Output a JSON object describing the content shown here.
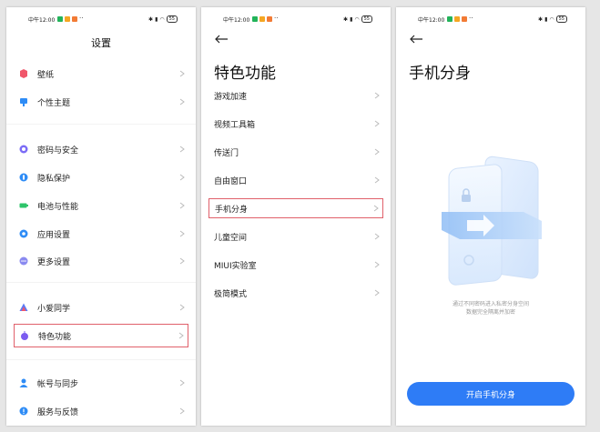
{
  "status": {
    "time": "中午12:00",
    "more": "··",
    "battery": "55",
    "dot_colors": [
      "#22b35a",
      "#f5a623",
      "#f27b35"
    ]
  },
  "panel1": {
    "title": "设置",
    "items": [
      {
        "label": "壁纸",
        "icon": "wallpaper-icon",
        "color": "#f0566a"
      },
      {
        "label": "个性主题",
        "icon": "theme-icon",
        "color": "#2e8cf6"
      },
      {
        "label": "密码与安全",
        "icon": "lock-icon",
        "color": "#7b6cf6"
      },
      {
        "label": "隐私保护",
        "icon": "privacy-icon",
        "color": "#2e8cf6"
      },
      {
        "label": "电池与性能",
        "icon": "battery-icon",
        "color": "#2ec46a"
      },
      {
        "label": "应用设置",
        "icon": "gear-icon",
        "color": "#2e8cf6"
      },
      {
        "label": "更多设置",
        "icon": "more-icon",
        "color": "#8a8af0"
      },
      {
        "label": "小爱同学",
        "icon": "assistant-icon",
        "color": "#5a7cf6"
      },
      {
        "label": "特色功能",
        "icon": "features-icon",
        "color": "#7b5cf0"
      },
      {
        "label": "帐号与同步",
        "icon": "account-icon",
        "color": "#2e8cf6"
      },
      {
        "label": "服务与反馈",
        "icon": "feedback-icon",
        "color": "#2e8cf6"
      }
    ]
  },
  "panel2": {
    "title": "特色功能",
    "items": [
      "游戏加速",
      "视频工具箱",
      "传送门",
      "自由窗口",
      "手机分身",
      "儿童空间",
      "MIUI实验室",
      "极简模式"
    ]
  },
  "panel3": {
    "title": "手机分身",
    "desc_line1": "通过不同密码进入私密分身空间",
    "desc_line2": "数据完全隔离并加密",
    "button": "开启手机分身"
  },
  "colors": {
    "accent": "#2e7cf6",
    "highlight_border": "#e0606a"
  }
}
